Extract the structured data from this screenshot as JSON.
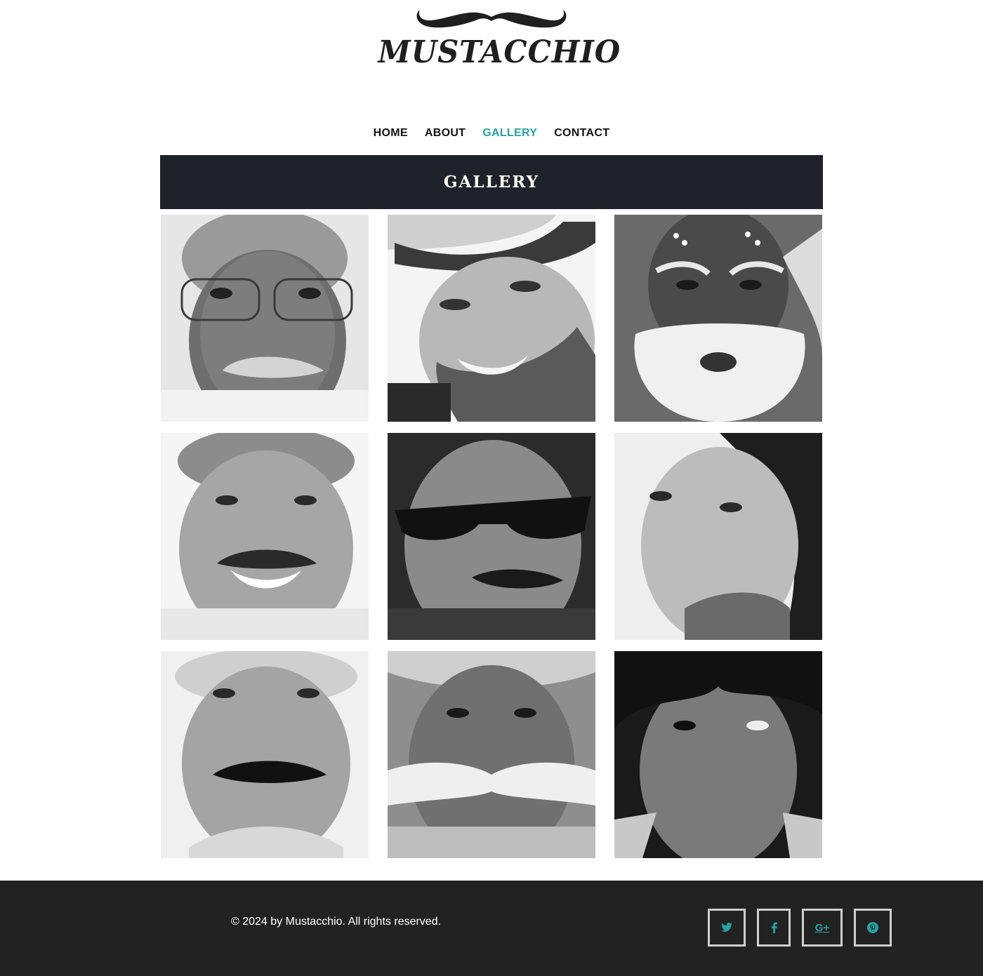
{
  "brand": {
    "name": "MUSTACCHIO"
  },
  "nav": {
    "items": [
      {
        "label": "HOME",
        "active": false
      },
      {
        "label": "ABOUT",
        "active": false
      },
      {
        "label": "GALLERY",
        "active": true
      },
      {
        "label": "CONTACT",
        "active": false
      }
    ]
  },
  "page": {
    "title": "GALLERY"
  },
  "gallery": {
    "photos": [
      {
        "alt": ""
      },
      {
        "alt": ""
      },
      {
        "alt": ""
      },
      {
        "alt": ""
      },
      {
        "alt": ""
      },
      {
        "alt": ""
      },
      {
        "alt": ""
      },
      {
        "alt": ""
      },
      {
        "alt": ""
      }
    ]
  },
  "footer": {
    "copyright": "© 2024 by Mustacchio. All rights reserved.",
    "social": [
      {
        "icon": "twitter-icon"
      },
      {
        "icon": "facebook-icon"
      },
      {
        "icon": "google-plus-icon",
        "label": "G+"
      },
      {
        "icon": "pinterest-icon"
      }
    ]
  },
  "colors": {
    "accent": "#21a3a0",
    "banner": "#1f2329",
    "footer": "#222222"
  }
}
